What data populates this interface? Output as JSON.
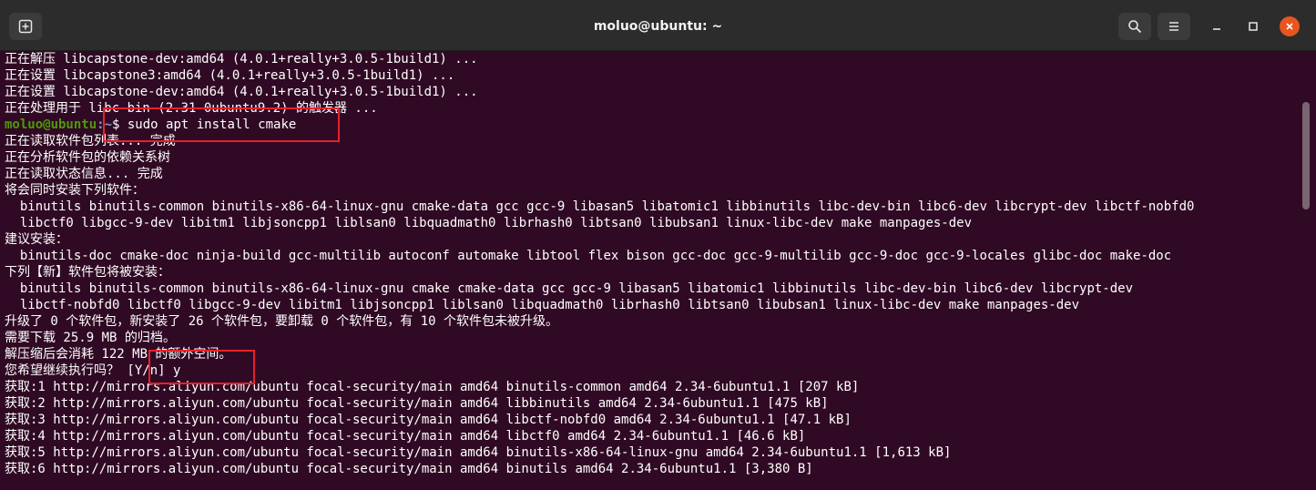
{
  "window": {
    "title": "moluo@ubuntu: ~",
    "new_tab_icon": "new-tab-icon",
    "search_icon": "search-icon",
    "menu_icon": "hamburger-menu-icon",
    "minimize_icon": "minimize-icon",
    "maximize_icon": "maximize-icon",
    "close_icon": "close-icon",
    "accent": "#e95420"
  },
  "colors": {
    "background": "#300a24",
    "text": "#ffffff",
    "prompt_user": "#4e9a06",
    "prompt_path": "#729fcf",
    "highlight_box": "#e8202a"
  },
  "terminal": {
    "lines": [
      "正在解压 libcapstone-dev:amd64 (4.0.1+really+3.0.5-1build1) ...",
      "正在设置 libcapstone3:amd64 (4.0.1+really+3.0.5-1build1) ...",
      "正在设置 libcapstone-dev:amd64 (4.0.1+really+3.0.5-1build1) ...",
      "正在处理用于 libc-bin (2.31-0ubuntu9.2) 的触发器 ..."
    ],
    "prompt": {
      "user_host": "moluo@ubuntu",
      "path": ":~",
      "symbol": "$ ",
      "command": "sudo apt install cmake"
    },
    "output_lines": [
      "正在读取软件包列表... 完成",
      "正在分析软件包的依赖关系树",
      "正在读取状态信息... 完成",
      "将会同时安装下列软件：",
      "  binutils binutils-common binutils-x86-64-linux-gnu cmake-data gcc gcc-9 libasan5 libatomic1 libbinutils libc-dev-bin libc6-dev libcrypt-dev libctf-nobfd0",
      "  libctf0 libgcc-9-dev libitm1 libjsoncpp1 liblsan0 libquadmath0 librhash0 libtsan0 libubsan1 linux-libc-dev make manpages-dev",
      "建议安装：",
      "  binutils-doc cmake-doc ninja-build gcc-multilib autoconf automake libtool flex bison gcc-doc gcc-9-multilib gcc-9-doc gcc-9-locales glibc-doc make-doc",
      "下列【新】软件包将被安装：",
      "  binutils binutils-common binutils-x86-64-linux-gnu cmake cmake-data gcc gcc-9 libasan5 libatomic1 libbinutils libc-dev-bin libc6-dev libcrypt-dev",
      "  libctf-nobfd0 libctf0 libgcc-9-dev libitm1 libjsoncpp1 liblsan0 libquadmath0 librhash0 libtsan0 libubsan1 linux-libc-dev make manpages-dev",
      "升级了 0 个软件包，新安装了 26 个软件包，要卸载 0 个软件包，有 10 个软件包未被升级。",
      "需要下载 25.9 MB 的归档。",
      "解压缩后会消耗 122 MB 的额外空间。",
      "您希望继续执行吗？ [Y/n] y",
      "获取:1 http://mirrors.aliyun.com/ubuntu focal-security/main amd64 binutils-common amd64 2.34-6ubuntu1.1 [207 kB]",
      "获取:2 http://mirrors.aliyun.com/ubuntu focal-security/main amd64 libbinutils amd64 2.34-6ubuntu1.1 [475 kB]",
      "获取:3 http://mirrors.aliyun.com/ubuntu focal-security/main amd64 libctf-nobfd0 amd64 2.34-6ubuntu1.1 [47.1 kB]",
      "获取:4 http://mirrors.aliyun.com/ubuntu focal-security/main amd64 libctf0 amd64 2.34-6ubuntu1.1 [46.6 kB]",
      "获取:5 http://mirrors.aliyun.com/ubuntu focal-security/main amd64 binutils-x86-64-linux-gnu amd64 2.34-6ubuntu1.1 [1,613 kB]",
      "获取:6 http://mirrors.aliyun.com/ubuntu focal-security/main amd64 binutils amd64 2.34-6ubuntu1.1 [3,380 B]"
    ]
  }
}
